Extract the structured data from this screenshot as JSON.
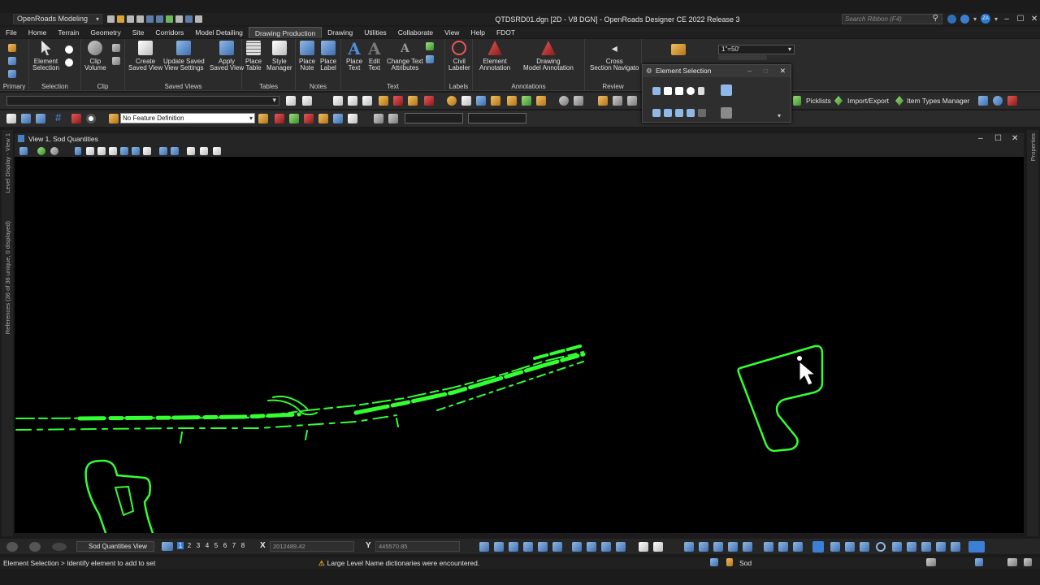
{
  "app": {
    "workspace": "OpenRoads Modeling",
    "title": "QTDSRD01.dgn [2D - V8 DGN] - OpenRoads Designer CE 2022 Release 3",
    "search_placeholder": "Search Ribbon (F4)",
    "user_initials": "ZA"
  },
  "menu": {
    "tabs": [
      {
        "label": "File"
      },
      {
        "label": "Home"
      },
      {
        "label": "Terrain"
      },
      {
        "label": "Geometry"
      },
      {
        "label": "Site"
      },
      {
        "label": "Corridors"
      },
      {
        "label": "Model Detailing"
      },
      {
        "label": "Drawing Production",
        "active": true
      },
      {
        "label": "Drawing"
      },
      {
        "label": "Utilities"
      },
      {
        "label": "Collaborate"
      },
      {
        "label": "View"
      },
      {
        "label": "Help"
      },
      {
        "label": "FDOT"
      }
    ]
  },
  "ribbon": {
    "groups": {
      "primary": "Primary",
      "selection": "Selection",
      "clip": "Clip",
      "saved_views": "Saved Views",
      "tables": "Tables",
      "notes": "Notes",
      "text": "Text",
      "labels": "Labels",
      "annotations": "Annotations",
      "review": "Review"
    },
    "buttons": {
      "element_selection": [
        "Element",
        "Selection"
      ],
      "clip_volume": [
        "Clip",
        "Volume"
      ],
      "create_saved_view": [
        "Create",
        "Saved View"
      ],
      "update_saved_view": [
        "Update Saved",
        "View Settings"
      ],
      "apply_saved_view": [
        "Apply",
        "Saved View"
      ],
      "place_table": [
        "Place",
        "Table"
      ],
      "style_manager": [
        "Style",
        "Manager"
      ],
      "place_note": [
        "Place",
        "Note"
      ],
      "place_label": [
        "Place",
        "Label"
      ],
      "place_text": [
        "Place",
        "Text"
      ],
      "edit_text": [
        "Edit",
        "Text"
      ],
      "change_text_attributes": [
        "Change Text",
        "Attributes"
      ],
      "civil_labeler": [
        "Civil",
        "Labeler"
      ],
      "element_annotation": [
        "Element",
        "Annotation"
      ],
      "drawing_model_annotation": [
        "Drawing",
        "Model Annotation"
      ],
      "cross_section_navigator": [
        "Cross",
        "Section Navigato"
      ]
    },
    "scale": "1\"=50'"
  },
  "element_selection_panel": {
    "title": "Element Selection"
  },
  "toolbar": {
    "feature_definition": "No Feature Definition",
    "picklists": "Picklists",
    "import_export": "Import/Export",
    "item_types_manager": "Item Types Manager"
  },
  "view": {
    "title": "View 1, Sod Quantities",
    "background_color": "#000000",
    "linework_color": "#33ff33"
  },
  "side_panels": {
    "level_display": "Level Display - View 1",
    "references": "References (36 of 36 unique, 0 displayed)",
    "properties": "Properties"
  },
  "status": {
    "view_name": "Sod Quantities View",
    "view_numbers": [
      "1",
      "2",
      "3",
      "4",
      "5",
      "6",
      "7",
      "8"
    ],
    "x_label": "X",
    "x_value": "2012489.42",
    "y_label": "Y",
    "y_value": "445570.85",
    "prompt": "Element Selection > Identify element to add to set",
    "warning": "Large Level Name dictionaries were encountered.",
    "active_level": "Sod"
  }
}
